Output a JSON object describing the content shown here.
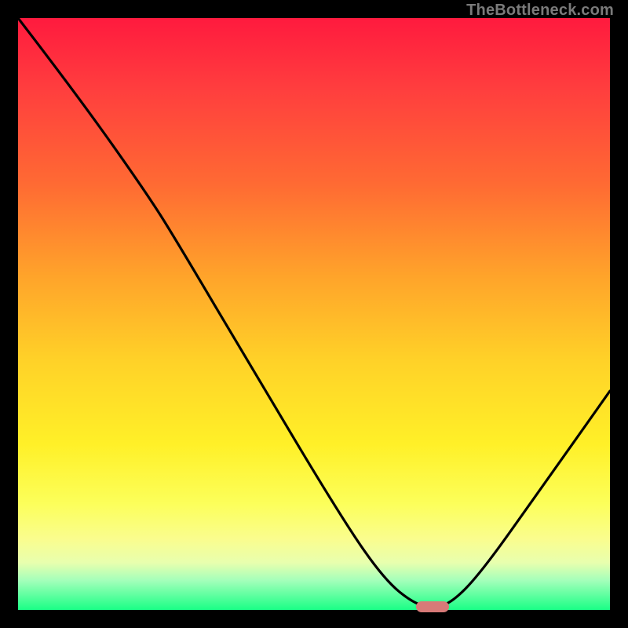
{
  "watermark": "TheBottleneck.com",
  "colors": {
    "frame": "#000000",
    "marker": "#d87a78",
    "curve": "#000000"
  },
  "chart_data": {
    "type": "line",
    "title": "",
    "xlabel": "",
    "ylabel": "",
    "xlim": [
      0,
      100
    ],
    "ylim": [
      0,
      100
    ],
    "grid": false,
    "legend": false,
    "curve_points": [
      {
        "x": 0,
        "y": 100
      },
      {
        "x": 10,
        "y": 87
      },
      {
        "x": 22,
        "y": 70
      },
      {
        "x": 27,
        "y": 62
      },
      {
        "x": 40,
        "y": 40
      },
      {
        "x": 55,
        "y": 15
      },
      {
        "x": 62,
        "y": 5
      },
      {
        "x": 67,
        "y": 1
      },
      {
        "x": 70,
        "y": 0.5
      },
      {
        "x": 73,
        "y": 1
      },
      {
        "x": 78,
        "y": 6
      },
      {
        "x": 88,
        "y": 20
      },
      {
        "x": 100,
        "y": 37
      }
    ],
    "optimal_marker": {
      "x_center": 70,
      "y": 0.5,
      "width_pct": 5.6
    }
  }
}
